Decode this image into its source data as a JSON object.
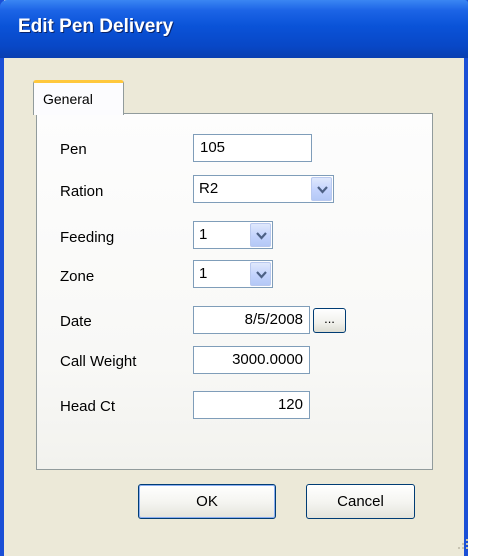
{
  "window": {
    "title": "Edit Pen Delivery"
  },
  "tabs": [
    {
      "label": "General"
    }
  ],
  "form": {
    "pen": {
      "label": "Pen",
      "value": "105"
    },
    "ration": {
      "label": "Ration",
      "value": "R2"
    },
    "feeding": {
      "label": "Feeding",
      "value": "1"
    },
    "zone": {
      "label": "Zone",
      "value": "1"
    },
    "date": {
      "label": "Date",
      "value": "8/5/2008",
      "browse_label": "..."
    },
    "call_weight": {
      "label": "Call Weight",
      "value": "3000.0000"
    },
    "head_ct": {
      "label": "Head Ct",
      "value": "120"
    }
  },
  "buttons": {
    "ok_label": "OK",
    "cancel_label": "Cancel"
  },
  "icons": {
    "dropdown": "chevron-down-icon",
    "resize": "resize-grip-icon"
  },
  "colors": {
    "titlebar": "#0a53d8",
    "tab_accent": "#ffc83c",
    "dialog_bg": "#ece9d8",
    "input_border": "#7f9db9"
  }
}
